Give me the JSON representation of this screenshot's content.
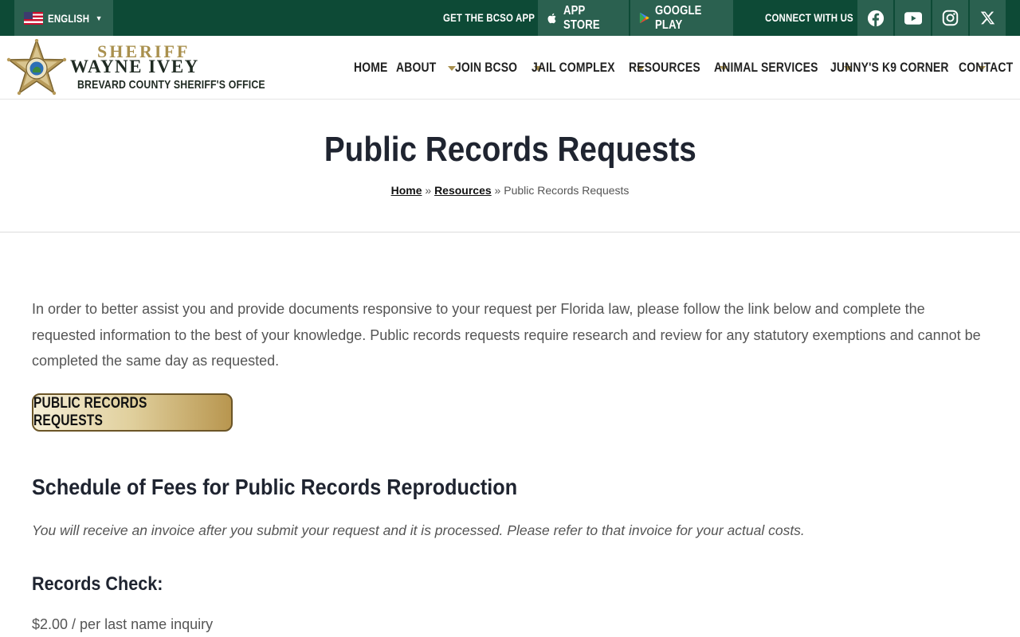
{
  "topbar": {
    "language": "ENGLISH",
    "get_app": "GET THE BCSO APP",
    "app_store": "APP STORE",
    "google_play": "GOOGLE PLAY",
    "connect": "CONNECT WITH US",
    "social_icons": [
      "facebook-icon",
      "youtube-icon",
      "instagram-icon",
      "x-icon"
    ],
    "colors": {
      "bar": "#0d4a36",
      "tile": "#2b6150"
    }
  },
  "brand": {
    "sheriff": "SHERIFF",
    "name": "WAYNE IVEY",
    "office": "BREVARD COUNTY SHERIFF'S OFFICE",
    "colors": {
      "gold": "#a9904e",
      "dark": "#1f2a22"
    }
  },
  "nav": {
    "items": [
      {
        "label": "HOME"
      },
      {
        "label": "ABOUT"
      },
      {
        "label": "JOIN BCSO"
      },
      {
        "label": "JAIL COMPLEX"
      },
      {
        "label": "RESOURCES"
      },
      {
        "label": "ANIMAL SERVICES"
      },
      {
        "label": "JUNNY'S K9 CORNER"
      },
      {
        "label": "CONTACT"
      }
    ]
  },
  "page": {
    "title": "Public Records Requests",
    "breadcrumb": {
      "home": "Home",
      "sep1": "»",
      "resources": "Resources",
      "sep2": "»",
      "current": "Public Records Requests"
    }
  },
  "content": {
    "intro": "In order to better assist you and provide documents responsive to your request per Florida law, please follow the link below and complete the requested information to the best of your knowledge. Public records requests require research and review for any statutory exemptions and cannot be completed the same day as requested.",
    "button": "PUBLIC RECORDS REQUESTS",
    "fees_heading": "Schedule of Fees for Public Records Reproduction",
    "fees_note": "You will receive an invoice after you submit your request and it is processed. Please refer to that invoice for your actual costs.",
    "records_check_heading": "Records Check:",
    "records_check_fee": "$2.00 / per last name inquiry"
  }
}
